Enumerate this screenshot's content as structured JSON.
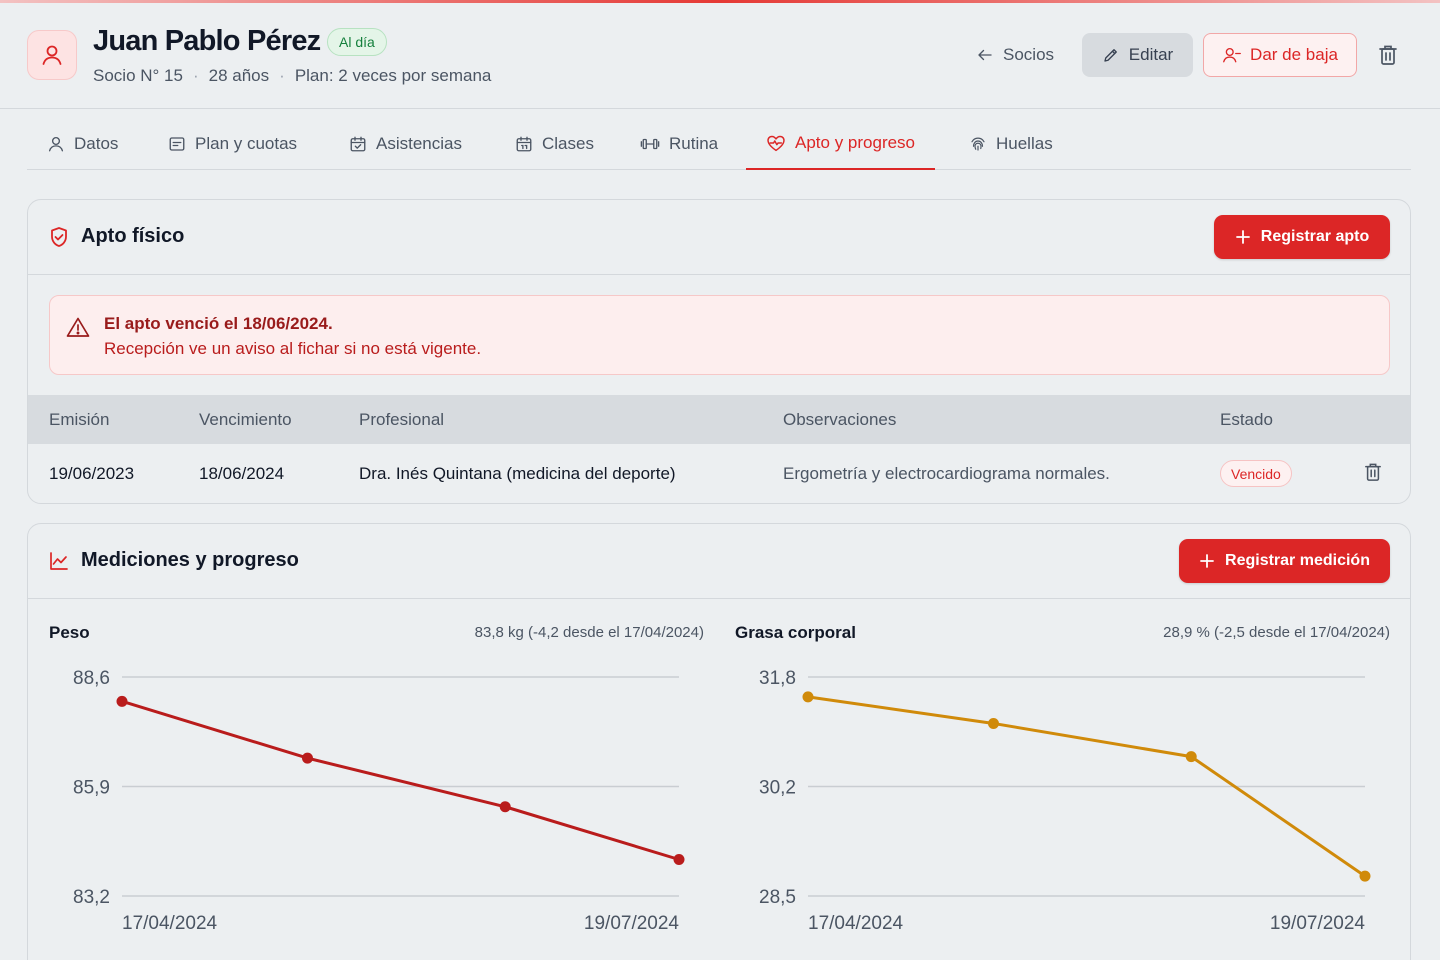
{
  "header": {
    "name": "Juan Pablo Pérez",
    "status_badge": "Al día",
    "member_number": "Socio N° 15",
    "age": "28 años",
    "plan": "Plan: 2 veces por semana",
    "separator": "·",
    "back_label": "Socios",
    "edit_label": "Editar",
    "unsubscribe_label": "Dar de baja"
  },
  "tabs": [
    {
      "label": "Datos",
      "icon": "user-icon"
    },
    {
      "label": "Plan y cuotas",
      "icon": "receipt-icon"
    },
    {
      "label": "Asistencias",
      "icon": "calendar-check-icon"
    },
    {
      "label": "Clases",
      "icon": "calendar-icon"
    },
    {
      "label": "Rutina",
      "icon": "dumbbell-icon"
    },
    {
      "label": "Apto y progreso",
      "icon": "heart-pulse-icon",
      "active": true
    },
    {
      "label": "Huellas",
      "icon": "fingerprint-icon"
    }
  ],
  "apto": {
    "title": "Apto físico",
    "register_label": "Registrar apto",
    "alert_title": "El apto venció el 18/06/2024.",
    "alert_text": "Recepción ve un aviso al fichar si no está vigente.",
    "columns": [
      "Emisión",
      "Vencimiento",
      "Profesional",
      "Observaciones",
      "Estado"
    ],
    "rows": [
      {
        "emision": "19/06/2023",
        "vencimiento": "18/06/2024",
        "profesional": "Dra. Inés Quintana (medicina del deporte)",
        "observaciones": "Ergometría y electrocardiograma normales.",
        "estado": "Vencido"
      }
    ]
  },
  "mediciones": {
    "title": "Mediciones y progreso",
    "register_label": "Registrar medición"
  },
  "colors": {
    "accent": "#dc2626",
    "weight_line": "#b91c1c",
    "fat_line": "#d08a0a",
    "success": "#15803d"
  },
  "chart_data": [
    {
      "type": "line",
      "title": "Peso",
      "summary": "83,8 kg (-4,2 desde el 17/04/2024)",
      "x": [
        "17/04/2024",
        "",
        "",
        "19/07/2024"
      ],
      "x_fraction": [
        0,
        0.333,
        0.688,
        1
      ],
      "series": [
        {
          "values": [
            88.0,
            86.6,
            85.4,
            84.1
          ]
        }
      ],
      "ylim": [
        83.2,
        88.6
      ],
      "yticks": [
        "88,6",
        "85,9",
        "83,2"
      ],
      "xticks": [
        "17/04/2024",
        "19/07/2024"
      ],
      "grid": true,
      "color": "#b91c1c"
    },
    {
      "type": "line",
      "title": "Grasa corporal",
      "summary": "28,9 % (-2,5 desde el 17/04/2024)",
      "x": [
        "17/04/2024",
        "",
        "",
        "19/07/2024"
      ],
      "x_fraction": [
        0,
        0.333,
        0.688,
        1
      ],
      "series": [
        {
          "values": [
            31.5,
            31.1,
            30.6,
            28.8
          ]
        }
      ],
      "ylim": [
        28.5,
        31.8
      ],
      "yticks": [
        "31,8",
        "30,2",
        "28,5"
      ],
      "xticks": [
        "17/04/2024",
        "19/07/2024"
      ],
      "grid": true,
      "color": "#d08a0a"
    }
  ]
}
